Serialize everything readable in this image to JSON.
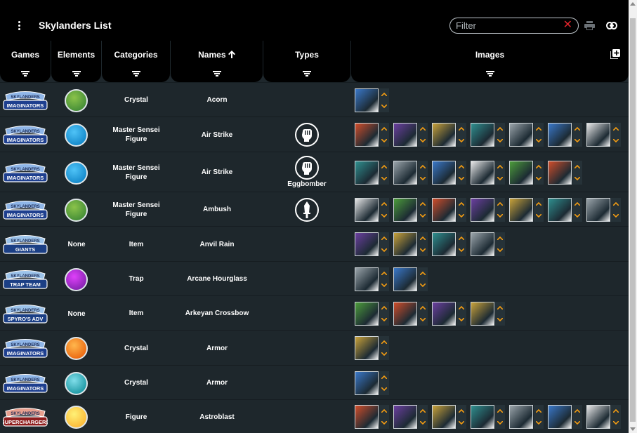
{
  "app": {
    "title": "Skylanders List",
    "filter_placeholder": "Filter",
    "filter_value": ""
  },
  "icons": {
    "menu": "more-vert-icon",
    "clear": "close-icon",
    "print": "print-icon",
    "link": "link-icon",
    "add_column": "add-box-icon",
    "sort": "arrow-up-icon",
    "filter": "filter-list-icon",
    "move_up": "chevron-up-icon",
    "move_down": "chevron-down-icon"
  },
  "colors": {
    "background": "#1e272c",
    "header": "#000000",
    "accent": "#f39c12",
    "clear": "#e0242b"
  },
  "columns": [
    {
      "label": "Games"
    },
    {
      "label": "Elements"
    },
    {
      "label": "Categories"
    },
    {
      "label": "Names",
      "sort": "ascending"
    },
    {
      "label": "Types"
    },
    {
      "label": "Images"
    }
  ],
  "rows": [
    {
      "game": "imaginators",
      "game_logo": [
        "SKYLANDERS",
        "IMAGINATORS"
      ],
      "element": "Life",
      "category": "Crystal",
      "name": "Acorn",
      "type": "",
      "type_label": "",
      "images": 1
    },
    {
      "game": "imaginators",
      "game_logo": [
        "SKYLANDERS",
        "IMAGINATORS"
      ],
      "element": "Air",
      "category": "Master Sensei Figure",
      "name": "Air Strike",
      "type": "Brawler",
      "type_label": "",
      "images": 7
    },
    {
      "game": "imaginators",
      "game_logo": [
        "SKYLANDERS",
        "IMAGINATORS"
      ],
      "element": "Air",
      "category": "Master Sensei Figure",
      "name": "Air Strike",
      "type": "Brawler",
      "type_label": "Eggbomber",
      "images": 6
    },
    {
      "game": "imaginators",
      "game_logo": [
        "SKYLANDERS",
        "IMAGINATORS"
      ],
      "element": "Life",
      "category": "Master Sensei Figure",
      "name": "Ambush",
      "type": "Knight",
      "type_label": "",
      "images": 7
    },
    {
      "game": "giants",
      "game_logo": [
        "SKYLANDERS",
        "GIANTS"
      ],
      "element": "None",
      "category": "Item",
      "name": "Anvil Rain",
      "type": "",
      "type_label": "",
      "images": 4
    },
    {
      "game": "trap-team",
      "game_logo": [
        "SKYLANDERS",
        "TRAP TEAM"
      ],
      "element": "Magic",
      "category": "Trap",
      "name": "Arcane Hourglass",
      "type": "",
      "type_label": "",
      "images": 2
    },
    {
      "game": "spyros",
      "game_logo": [
        "SKYLANDERS",
        "SPYRO'S ADV"
      ],
      "element": "None",
      "category": "Item",
      "name": "Arkeyan Crossbow",
      "type": "",
      "type_label": "",
      "images": 4
    },
    {
      "game": "imaginators",
      "game_logo": [
        "SKYLANDERS",
        "IMAGINATORS"
      ],
      "element": "Tech",
      "category": "Crystal",
      "name": "Armor",
      "type": "",
      "type_label": "",
      "images": 1
    },
    {
      "game": "imaginators",
      "game_logo": [
        "SKYLANDERS",
        "IMAGINATORS"
      ],
      "element": "Water",
      "category": "Crystal",
      "name": "Armor",
      "type": "",
      "type_label": "",
      "images": 1
    },
    {
      "game": "superchargers",
      "game_logo": [
        "SKYLANDERS",
        "SUPERCHARGERS"
      ],
      "element": "Light",
      "category": "Figure",
      "name": "Astroblast",
      "type": "",
      "type_label": "",
      "images": 7
    }
  ]
}
